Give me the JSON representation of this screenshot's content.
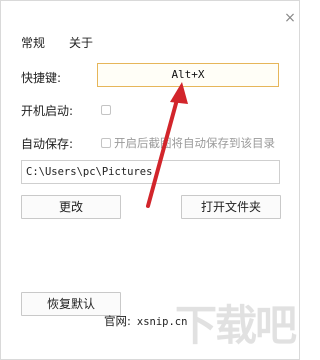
{
  "tabs": [
    "常规",
    "关于"
  ],
  "hotkey": {
    "label": "快捷键:",
    "value": "Alt+X"
  },
  "startup": {
    "label": "开机启动:"
  },
  "autosave": {
    "label": "自动保存:",
    "option_text": "开启后截图将自动保存到该目录"
  },
  "save_path": "C:\\Users\\pc\\Pictures",
  "buttons": {
    "change": "更改",
    "open_folder": "打开文件夹",
    "restore_default": "恢复默认"
  },
  "footer": {
    "site_label": "官网:",
    "site_url": "xsnip.cn"
  },
  "watermark": "下载吧",
  "colors": {
    "arrow": "#d2252b",
    "hotkey_border": "#e6b65a"
  }
}
